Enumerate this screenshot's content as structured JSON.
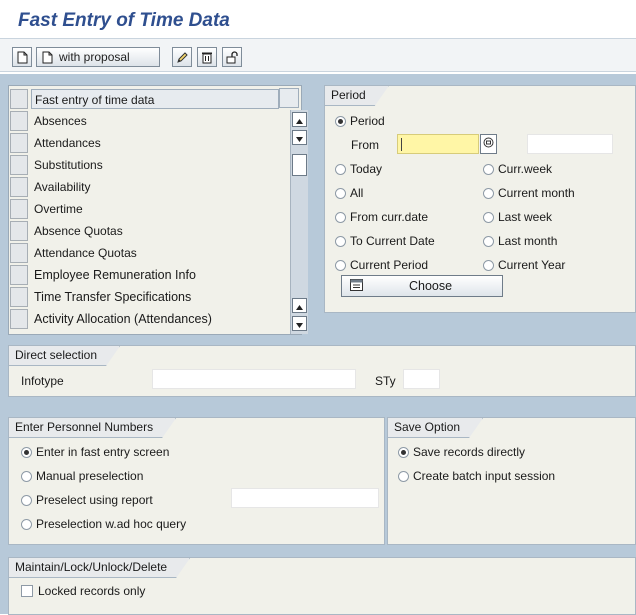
{
  "app": {
    "title": "Fast Entry of Time Data"
  },
  "toolbar": {
    "with_proposal_label": "with proposal",
    "icons": [
      "new-document-icon",
      "new-with-proposal-icon",
      "pencil-icon",
      "trash-icon",
      "lock-icon"
    ]
  },
  "infotype_list": {
    "items": [
      "Fast entry of time data",
      "Absences",
      "Attendances",
      "Substitutions",
      "Availability",
      "Overtime",
      "Absence Quotas",
      "Attendance Quotas",
      "Employee Remuneration Info",
      "Time Transfer Specifications",
      "Activity Allocation (Attendances)"
    ]
  },
  "period": {
    "title": "Period",
    "period_option": "Period",
    "from_label": "From",
    "from_value": "",
    "to_value": "",
    "options": [
      {
        "label": "Today",
        "selected": false
      },
      {
        "label": "Curr.week",
        "selected": false
      },
      {
        "label": "All",
        "selected": false
      },
      {
        "label": "Current month",
        "selected": false
      },
      {
        "label": "From curr.date",
        "selected": false
      },
      {
        "label": "Last week",
        "selected": false
      },
      {
        "label": "To Current Date",
        "selected": false
      },
      {
        "label": "Last month",
        "selected": false
      },
      {
        "label": "Current Period",
        "selected": false
      },
      {
        "label": "Current Year",
        "selected": false
      }
    ],
    "choose_label": "Choose"
  },
  "direct_selection": {
    "title": "Direct selection",
    "infotype_label": "Infotype",
    "infotype_value": "",
    "sty_label": "STy",
    "sty_value": ""
  },
  "personnel": {
    "title": "Enter Personnel Numbers",
    "options": [
      {
        "label": "Enter in fast entry screen",
        "selected": true
      },
      {
        "label": "Manual preselection",
        "selected": false
      },
      {
        "label": "Preselect using report",
        "selected": false
      },
      {
        "label": "Preselection w.ad hoc query",
        "selected": false
      }
    ],
    "report_value": ""
  },
  "save_option": {
    "title": "Save Option",
    "options": [
      {
        "label": "Save records directly",
        "selected": true
      },
      {
        "label": "Create batch input session",
        "selected": false
      }
    ]
  },
  "maintain": {
    "title": "Maintain/Lock/Unlock/Delete",
    "locked_only_label": "Locked records only",
    "locked_only_checked": false
  },
  "colors": {
    "title": "#2f4f8f",
    "background_blue": "#b7c9d9",
    "panel": "#f1f1ea",
    "required_field": "#fff6a6"
  }
}
